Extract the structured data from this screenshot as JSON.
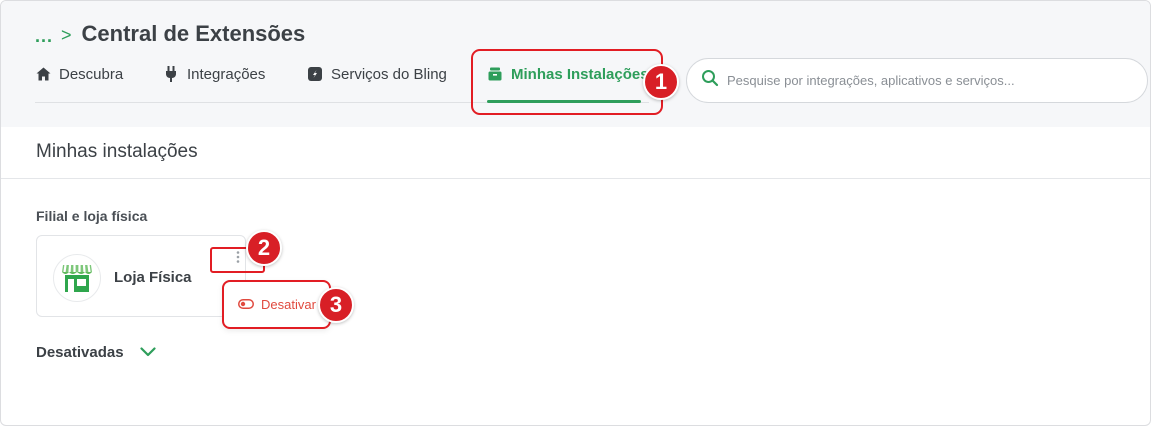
{
  "breadcrumb": {
    "ellipsis": "...",
    "separator": ">",
    "title": "Central de Extensões"
  },
  "tabs": [
    {
      "label": "Descubra",
      "icon": "home-icon",
      "active": false
    },
    {
      "label": "Integrações",
      "icon": "plug-icon",
      "active": false
    },
    {
      "label": "Serviços do Bling",
      "icon": "bling-icon",
      "active": false
    },
    {
      "label": "Minhas Instalações",
      "icon": "store-icon",
      "active": true
    }
  ],
  "search": {
    "placeholder": "Pesquise por integrações, aplicativos e serviços..."
  },
  "section": {
    "title": "Minhas instalações"
  },
  "group": {
    "label": "Filial e loja física"
  },
  "card": {
    "name": "Loja Física",
    "icon": "storefront-logo"
  },
  "menu": {
    "item_label": "Desativar",
    "item_icon": "toggle-icon"
  },
  "disabled_section": {
    "label": "Desativadas"
  },
  "annotations": {
    "step1": "1",
    "step2": "2",
    "step3": "3"
  },
  "colors": {
    "accent": "#2e9e5b",
    "highlight": "#e21d24",
    "danger_text": "#e04a3f",
    "badge": "#d81f26"
  }
}
